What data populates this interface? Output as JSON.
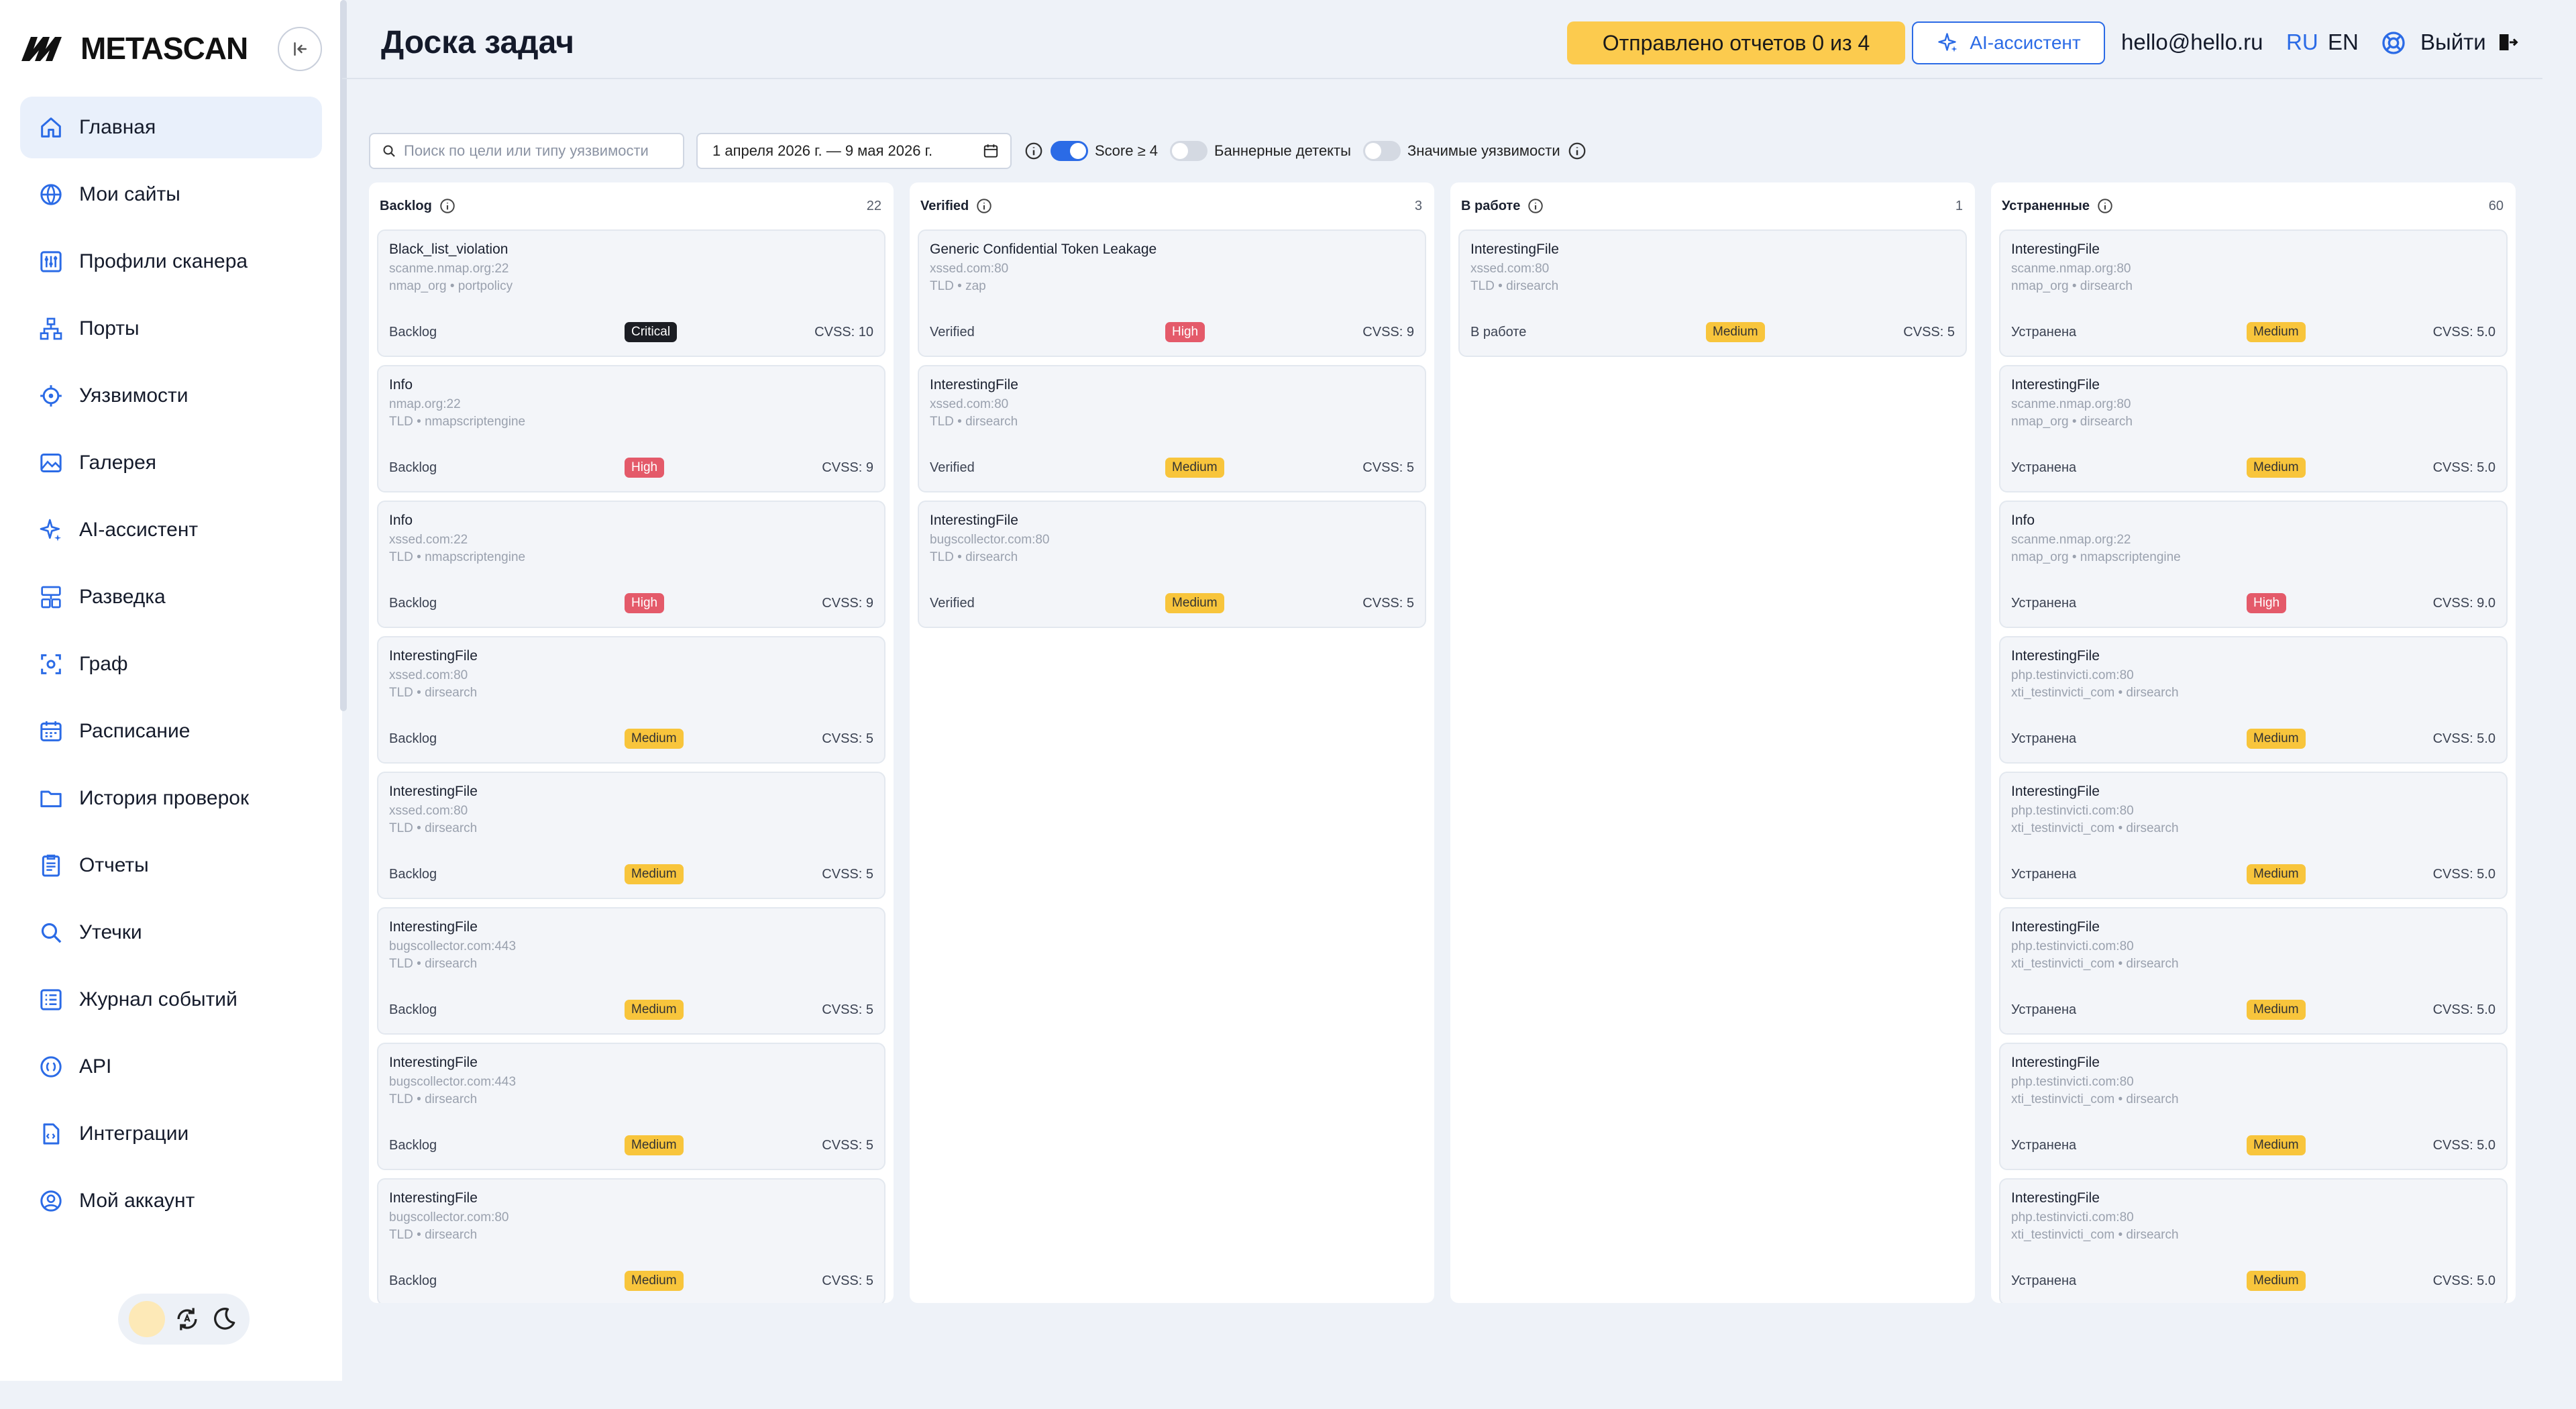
{
  "app": {
    "name": "METASCAN"
  },
  "sidebar": {
    "items": [
      {
        "label": "Главная",
        "icon": "home-icon",
        "active": true
      },
      {
        "label": "Мои сайты",
        "icon": "globe-icon"
      },
      {
        "label": "Профили сканера",
        "icon": "sliders-icon"
      },
      {
        "label": "Порты",
        "icon": "network-icon"
      },
      {
        "label": "Уязвимости",
        "icon": "target-icon"
      },
      {
        "label": "Галерея",
        "icon": "image-icon"
      },
      {
        "label": "AI-ассистент",
        "icon": "sparkle-icon"
      },
      {
        "label": "Разведка",
        "icon": "recon-icon"
      },
      {
        "label": "Граф",
        "icon": "graph-icon"
      },
      {
        "label": "Расписание",
        "icon": "calendar-icon"
      },
      {
        "label": "История проверок",
        "icon": "folder-icon"
      },
      {
        "label": "Отчеты",
        "icon": "report-icon"
      },
      {
        "label": "Утечки",
        "icon": "search-icon"
      },
      {
        "label": "Журнал событий",
        "icon": "list-icon"
      },
      {
        "label": "API",
        "icon": "api-icon"
      },
      {
        "label": "Интеграции",
        "icon": "code-file-icon"
      },
      {
        "label": "Мой аккаунт",
        "icon": "user-icon"
      }
    ]
  },
  "header": {
    "title": "Доска задач",
    "reports_badge": "Отправлено отчетов 0 из 4",
    "ai_button": "AI-ассистент",
    "email": "hello@hello.ru",
    "lang_ru": "RU",
    "lang_en": "EN",
    "logout": "Выйти"
  },
  "filters": {
    "search_placeholder": "Поиск по цели или типу уязвимости",
    "date_range": "1 апреля 2026 г. — 9 мая 2026 г.",
    "score_label": "Score ≥ 4",
    "score_on": true,
    "banner_label": "Баннерные детекты",
    "banner_on": false,
    "significant_label": "Значимые уязвимости",
    "significant_on": false
  },
  "colors": {
    "accent": "#2b6be6",
    "critical": "#1c1e24",
    "high": "#e45a6a",
    "medium": "#f8c53c",
    "badge": "#fccb4e"
  },
  "columns": [
    {
      "title": "Backlog",
      "count": "22",
      "cards": [
        {
          "title": "Black_list_violation",
          "host": "scanme.nmap.org:22",
          "source": "nmap_org • portpolicy",
          "status": "Backlog",
          "severity": "Critical",
          "cvss": "CVSS: 10"
        },
        {
          "title": "Info",
          "host": "nmap.org:22",
          "source": "TLD • nmapscriptengine",
          "status": "Backlog",
          "severity": "High",
          "cvss": "CVSS: 9"
        },
        {
          "title": "Info",
          "host": "xssed.com:22",
          "source": "TLD • nmapscriptengine",
          "status": "Backlog",
          "severity": "High",
          "cvss": "CVSS: 9"
        },
        {
          "title": "InterestingFile",
          "host": "xssed.com:80",
          "source": "TLD • dirsearch",
          "status": "Backlog",
          "severity": "Medium",
          "cvss": "CVSS: 5"
        },
        {
          "title": "InterestingFile",
          "host": "xssed.com:80",
          "source": "TLD • dirsearch",
          "status": "Backlog",
          "severity": "Medium",
          "cvss": "CVSS: 5"
        },
        {
          "title": "InterestingFile",
          "host": "bugscollector.com:443",
          "source": "TLD • dirsearch",
          "status": "Backlog",
          "severity": "Medium",
          "cvss": "CVSS: 5"
        },
        {
          "title": "InterestingFile",
          "host": "bugscollector.com:443",
          "source": "TLD • dirsearch",
          "status": "Backlog",
          "severity": "Medium",
          "cvss": "CVSS: 5"
        },
        {
          "title": "InterestingFile",
          "host": "bugscollector.com:80",
          "source": "TLD • dirsearch",
          "status": "Backlog",
          "severity": "Medium",
          "cvss": "CVSS: 5"
        }
      ]
    },
    {
      "title": "Verified",
      "count": "3",
      "cards": [
        {
          "title": "Generic Confidential Token Leakage",
          "host": "xssed.com:80",
          "source": "TLD • zap",
          "status": "Verified",
          "severity": "High",
          "cvss": "CVSS: 9"
        },
        {
          "title": "InterestingFile",
          "host": "xssed.com:80",
          "source": "TLD • dirsearch",
          "status": "Verified",
          "severity": "Medium",
          "cvss": "CVSS: 5"
        },
        {
          "title": "InterestingFile",
          "host": "bugscollector.com:80",
          "source": "TLD • dirsearch",
          "status": "Verified",
          "severity": "Medium",
          "cvss": "CVSS: 5"
        }
      ]
    },
    {
      "title": "В работе",
      "count": "1",
      "cards": [
        {
          "title": "InterestingFile",
          "host": "xssed.com:80",
          "source": "TLD • dirsearch",
          "status": "В работе",
          "severity": "Medium",
          "cvss": "CVSS: 5"
        }
      ]
    },
    {
      "title": "Устраненные",
      "count": "60",
      "cards": [
        {
          "title": "InterestingFile",
          "host": "scanme.nmap.org:80",
          "source": "nmap_org • dirsearch",
          "status": "Устранена",
          "severity": "Medium",
          "cvss": "CVSS: 5.0"
        },
        {
          "title": "InterestingFile",
          "host": "scanme.nmap.org:80",
          "source": "nmap_org • dirsearch",
          "status": "Устранена",
          "severity": "Medium",
          "cvss": "CVSS: 5.0"
        },
        {
          "title": "Info",
          "host": "scanme.nmap.org:22",
          "source": "nmap_org • nmapscriptengine",
          "status": "Устранена",
          "severity": "High",
          "cvss": "CVSS: 9.0"
        },
        {
          "title": "InterestingFile",
          "host": "php.testinvicti.com:80",
          "source": "xti_testinvicti_com • dirsearch",
          "status": "Устранена",
          "severity": "Medium",
          "cvss": "CVSS: 5.0"
        },
        {
          "title": "InterestingFile",
          "host": "php.testinvicti.com:80",
          "source": "xti_testinvicti_com • dirsearch",
          "status": "Устранена",
          "severity": "Medium",
          "cvss": "CVSS: 5.0"
        },
        {
          "title": "InterestingFile",
          "host": "php.testinvicti.com:80",
          "source": "xti_testinvicti_com • dirsearch",
          "status": "Устранена",
          "severity": "Medium",
          "cvss": "CVSS: 5.0"
        },
        {
          "title": "InterestingFile",
          "host": "php.testinvicti.com:80",
          "source": "xti_testinvicti_com • dirsearch",
          "status": "Устранена",
          "severity": "Medium",
          "cvss": "CVSS: 5.0"
        },
        {
          "title": "InterestingFile",
          "host": "php.testinvicti.com:80",
          "source": "xti_testinvicti_com • dirsearch",
          "status": "Устранена",
          "severity": "Medium",
          "cvss": "CVSS: 5.0"
        }
      ]
    }
  ]
}
